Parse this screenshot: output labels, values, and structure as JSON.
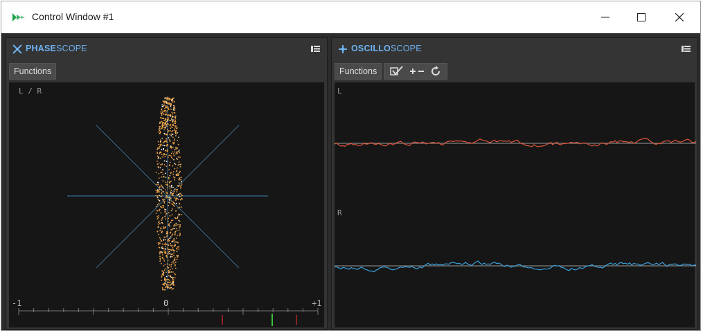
{
  "window": {
    "title": "Control Window #1",
    "minimize": "minimize",
    "maximize": "maximize",
    "close": "close"
  },
  "phasescope": {
    "title_strong": "PHASE",
    "title_light": "SCOPE",
    "functions_label": "Functions",
    "channel_label": "L / R",
    "scale_left": "-1",
    "scale_center": "0",
    "scale_right": "+1"
  },
  "oscilloscope": {
    "title_strong": "OSCILLO",
    "title_light": "SCOPE",
    "functions_label": "Functions",
    "channel_left_label": "L",
    "channel_right_label": "R"
  },
  "colors": {
    "accent": "#6db3f2",
    "left_trace": "#e0553a",
    "right_trace": "#3aa2e0",
    "dots": "#f0a040"
  }
}
